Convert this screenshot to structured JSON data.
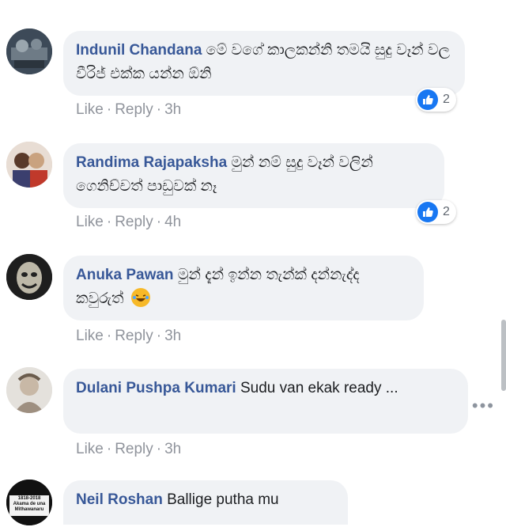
{
  "comments": [
    {
      "author": "Indunil Chandana",
      "text": "මේ වගේ කාලකන්නි තමයි සුදු වෑන් වල වීරිජ් එක්ක යන්න ඕනි",
      "like": "Like",
      "reply": "Reply",
      "time": "3h",
      "reactions": "2"
    },
    {
      "author": "Randima Rajapaksha",
      "text": "මුන් නම් සුදු වෑන් වලින් ගෙනිච්චත් පාඩුවක් නෑ",
      "like": "Like",
      "reply": "Reply",
      "time": "4h",
      "reactions": "2"
    },
    {
      "author": "Anuka Pawan",
      "text": "මුන් දැන් ඉන්න තැන්ක් දන්නැද්ද කවුරුත්",
      "like": "Like",
      "reply": "Reply",
      "time": "3h"
    },
    {
      "author": "Dulani Pushpa Kumari",
      "text": "Sudu van ekak ready ...",
      "like": "Like",
      "reply": "Reply",
      "time": "3h"
    },
    {
      "author": "Neil Roshan",
      "text": "Ballige putha mu",
      "avatar_text": "1818-2018 Akama de una Mithawanaru"
    }
  ],
  "more_label": "•••",
  "colors": {
    "author": "#385898",
    "bubble": "#f0f2f5",
    "meta": "#90949c",
    "like_blue": "#1877f2"
  }
}
